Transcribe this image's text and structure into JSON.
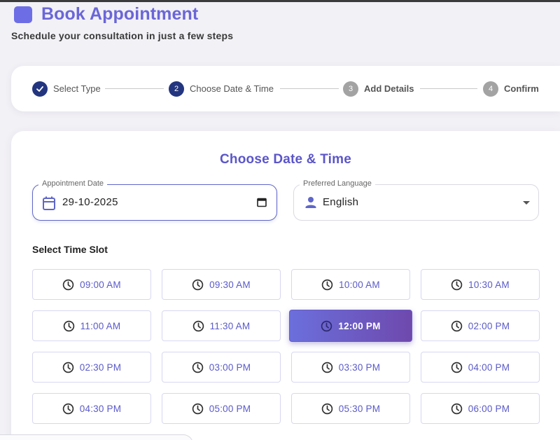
{
  "header": {
    "title": "Book Appointment",
    "subtitle": "Schedule your consultation in just a few steps",
    "logo_color": "#6d6ee6"
  },
  "stepper": {
    "steps": [
      {
        "number": "",
        "label": "Select Type",
        "status": "done"
      },
      {
        "number": "2",
        "label": "Choose Date & Time",
        "status": "active"
      },
      {
        "number": "3",
        "label": "Add Details",
        "status": "todo"
      },
      {
        "number": "4",
        "label": "Confirm",
        "status": "todo"
      }
    ]
  },
  "form": {
    "section_title": "Choose Date & Time",
    "date_field": {
      "label": "Appointment Date",
      "value": "29-10-2025",
      "icon": "calendar-icon"
    },
    "language_field": {
      "label": "Preferred Language",
      "value": "English",
      "icon": "person-icon"
    },
    "slot_section_title": "Select Time Slot",
    "time_slots": [
      {
        "label": "09:00 AM",
        "selected": false
      },
      {
        "label": "09:30 AM",
        "selected": false
      },
      {
        "label": "10:00 AM",
        "selected": false
      },
      {
        "label": "10:30 AM",
        "selected": false
      },
      {
        "label": "11:00 AM",
        "selected": false
      },
      {
        "label": "11:30 AM",
        "selected": false
      },
      {
        "label": "12:00 PM",
        "selected": true
      },
      {
        "label": "02:00 PM",
        "selected": false
      },
      {
        "label": "02:30 PM",
        "selected": false
      },
      {
        "label": "03:00 PM",
        "selected": false
      },
      {
        "label": "03:30 PM",
        "selected": false
      },
      {
        "label": "04:00 PM",
        "selected": false
      },
      {
        "label": "04:30 PM",
        "selected": false
      },
      {
        "label": "05:00 PM",
        "selected": false
      },
      {
        "label": "05:30 PM",
        "selected": false
      },
      {
        "label": "06:00 PM",
        "selected": false
      }
    ]
  },
  "colors": {
    "accent": "#6a66d8",
    "step_active": "#23357f",
    "step_todo": "#a3a3a3",
    "slot_text": "#5a5ac9",
    "selected_gradient_start": "#6b6fdc",
    "selected_gradient_end": "#6e49ad"
  }
}
